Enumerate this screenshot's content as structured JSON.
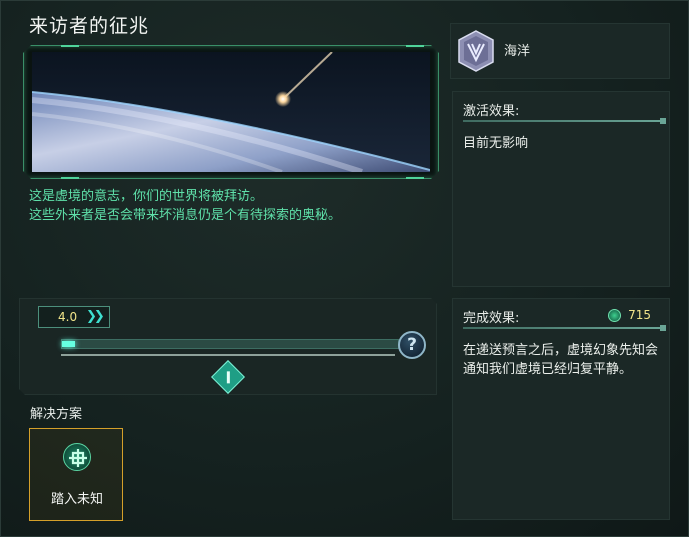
{
  "window": {
    "title": "来访者的征兆"
  },
  "event": {
    "description_lines": [
      "这是虚境的意志，你们的世界将被拜访。",
      "这些外来者是否会带来坏消息仍是个有待探索的奥秘。"
    ]
  },
  "slider": {
    "speed_value": "4.0",
    "speed_icon": "double-chevron-right-icon",
    "progress": 0.04,
    "help_label": "?",
    "help_icon": "question-mark-icon",
    "marker_icon": "diamond-marker-icon"
  },
  "resolution": {
    "label": "解决方案",
    "options": [
      {
        "label": "踏入未知",
        "icon": "knot-icon"
      }
    ]
  },
  "ethic": {
    "label": "海洋",
    "icon": "ocean-ethic-badge-icon"
  },
  "activation": {
    "header": "激活效果:",
    "body": "目前无影响"
  },
  "completion": {
    "header": "完成效果:",
    "cost": "715",
    "cost_icon": "research-points-icon",
    "body": "在递送预言之后，虚境幻象先知会通知我们虚境已经归复平静。"
  },
  "colors": {
    "accent_green": "#5fe1aa",
    "value_yellow": "#f1e48a",
    "option_border": "#d4a02a",
    "slider_fill": "#66ffe0"
  }
}
